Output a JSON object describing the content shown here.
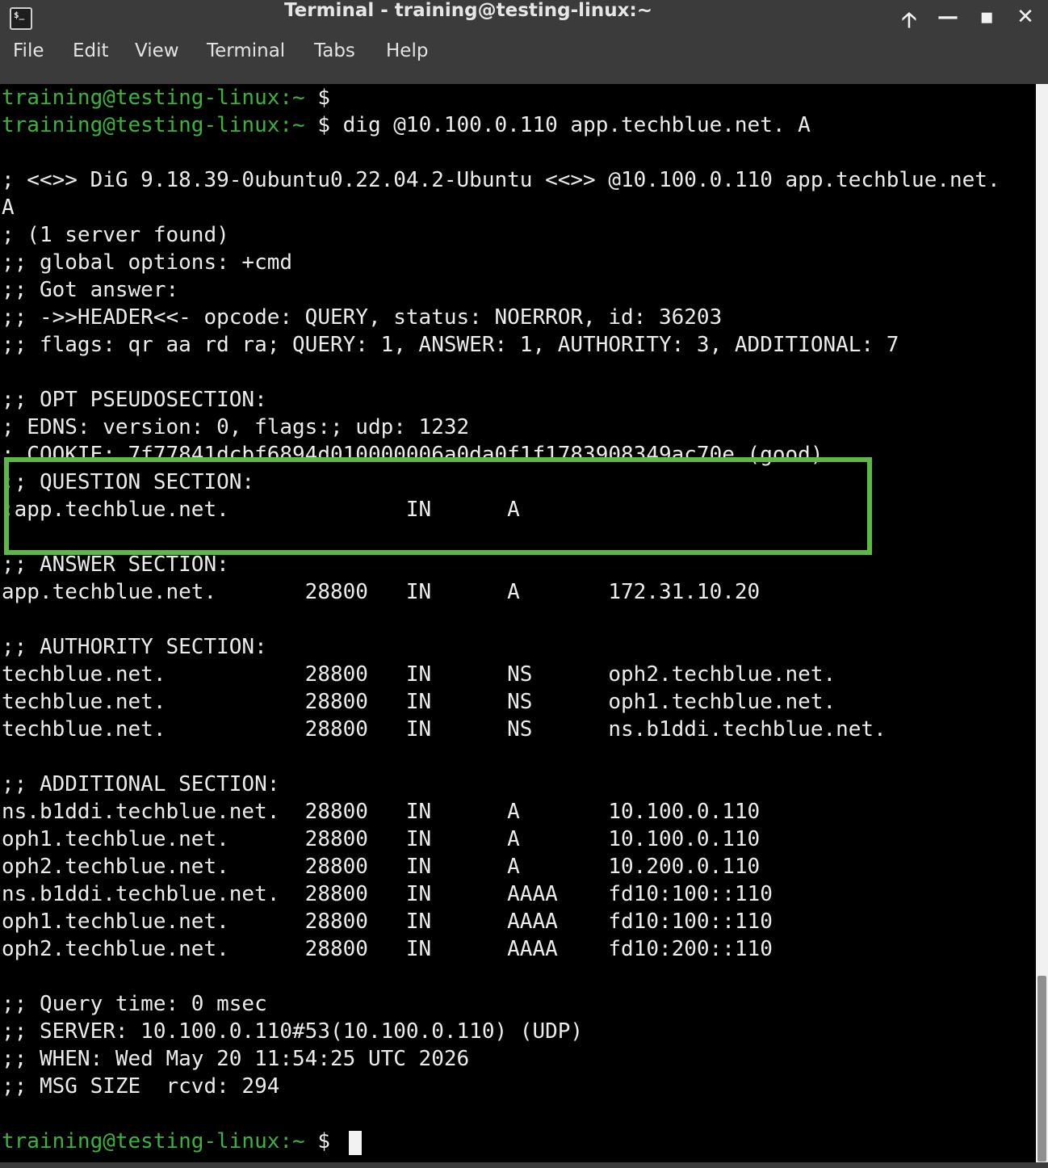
{
  "window": {
    "title": "Terminal - training@testing-linux:~",
    "app_icon_text": "$_"
  },
  "title_buttons": {
    "maximize_up": "🡡",
    "minimize": "—",
    "restore": "▪",
    "close": "✕"
  },
  "menu": [
    "File",
    "Edit",
    "View",
    "Terminal",
    "Tabs",
    "Help"
  ],
  "prompt": {
    "user_host": "training@testing-linux",
    "path": ":~",
    "symbol": " $"
  },
  "commands": {
    "first": "",
    "second": " dig @10.100.0.110 app.techblue.net. A",
    "current": " "
  },
  "output": [
    "; <<>> DiG 9.18.39-0ubuntu0.22.04.2-Ubuntu <<>> @10.100.0.110 app.techblue.net.",
    "A",
    "; (1 server found)",
    ";; global options: +cmd",
    ";; Got answer:",
    ";; ->>HEADER<<- opcode: QUERY, status: NOERROR, id: 36203",
    ";; flags: qr aa rd ra; QUERY: 1, ANSWER: 1, AUTHORITY: 3, ADDITIONAL: 7",
    ";; OPT PSEUDOSECTION:",
    "; EDNS: version: 0, flags:; udp: 1232",
    "; COOKIE: 7f77841dcbf6894d010000006a0da0f1f1783908349ac70e (good)",
    ";; QUESTION SECTION:",
    ";app.techblue.net.              IN      A",
    ";; ANSWER SECTION:",
    "app.techblue.net.       28800   IN      A       172.31.10.20",
    ";; AUTHORITY SECTION:",
    "techblue.net.           28800   IN      NS      oph2.techblue.net.",
    "techblue.net.           28800   IN      NS      oph1.techblue.net.",
    "techblue.net.           28800   IN      NS      ns.b1ddi.techblue.net.",
    ";; ADDITIONAL SECTION:",
    "ns.b1ddi.techblue.net.  28800   IN      A       10.100.0.110",
    "oph1.techblue.net.      28800   IN      A       10.100.0.110",
    "oph2.techblue.net.      28800   IN      A       10.200.0.110",
    "ns.b1ddi.techblue.net.  28800   IN      AAAA    fd10:100::110",
    "oph1.techblue.net.      28800   IN      AAAA    fd10:100::110",
    "oph2.techblue.net.      28800   IN      AAAA    fd10:200::110",
    ";; Query time: 0 msec",
    ";; SERVER: 10.100.0.110#53(10.100.0.110) (UDP)",
    ";; WHEN: Wed May 20 11:54:25 UTC 2026",
    ";; MSG SIZE  rcvd: 294"
  ],
  "colors": {
    "prompt": "#3cb33c",
    "highlight_border": "#5db846",
    "terminal_bg": "#000000",
    "chrome_bg": "#3b3b3b"
  }
}
